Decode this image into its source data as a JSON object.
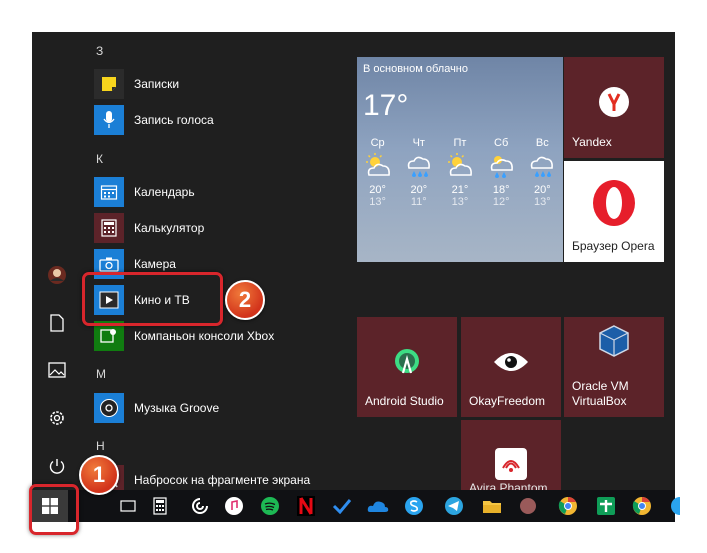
{
  "app_list": {
    "sections": [
      {
        "letter": "З",
        "items": [
          {
            "label": "Записки",
            "icon": "sticky-notes-icon"
          },
          {
            "label": "Запись голоса",
            "icon": "voice-recorder-icon"
          }
        ]
      },
      {
        "letter": "К",
        "items": [
          {
            "label": "Календарь",
            "icon": "calendar-icon"
          },
          {
            "label": "Калькулятор",
            "icon": "calculator-icon"
          },
          {
            "label": "Камера",
            "icon": "camera-icon"
          },
          {
            "label": "Кино и ТВ",
            "icon": "movies-tv-icon"
          },
          {
            "label": "Компаньон консоли Xbox",
            "icon": "xbox-icon"
          }
        ]
      },
      {
        "letter": "М",
        "items": [
          {
            "label": "Музыка Groove",
            "icon": "groove-music-icon"
          }
        ]
      },
      {
        "letter": "Н",
        "items": [
          {
            "label": "Набросок на фрагменте экрана",
            "icon": "snip-sketch-icon"
          }
        ]
      }
    ]
  },
  "weather": {
    "condition": "В основном облачно",
    "temperature": "17°",
    "days": [
      {
        "name": "Ср",
        "high": "20°",
        "low": "13°"
      },
      {
        "name": "Чт",
        "high": "20°",
        "low": "11°"
      },
      {
        "name": "Пт",
        "high": "21°",
        "low": "13°"
      },
      {
        "name": "Сб",
        "high": "18°",
        "low": "12°"
      },
      {
        "name": "Вс",
        "high": "20°",
        "low": "13°"
      }
    ]
  },
  "tiles": {
    "yandex": "Yandex",
    "opera": "Браузер Opera",
    "android_studio": "Android Studio",
    "okayfreedom": "OkayFreedom",
    "virtualbox": "Oracle VM VirtualBox",
    "partial": "Avira Phantom"
  },
  "badges": {
    "one": "1",
    "two": "2"
  },
  "colors": {
    "tile_bg": "#5c2329",
    "accent_red": "#d8262c",
    "taskbar": "#101114",
    "start_bg": "#1f1f1f"
  }
}
